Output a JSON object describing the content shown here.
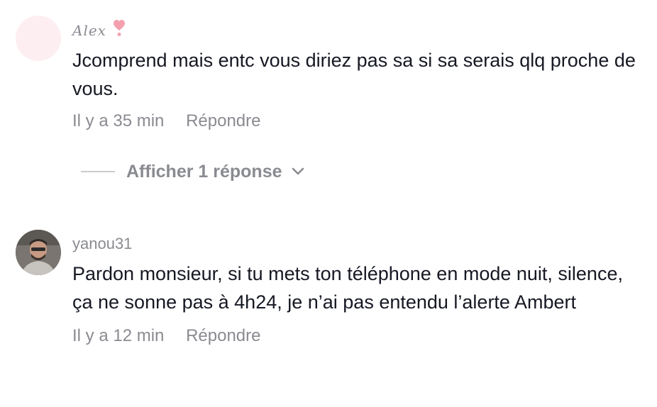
{
  "comments": [
    {
      "username": "Alex",
      "username_emoji": "heart-exclamation-icon",
      "text": "Jcomprend mais entc vous diriez pas sa si sa serais qlq proche de vous.",
      "time": "Il y a 35 min",
      "reply_label": "Répondre",
      "show_replies_label": "Afficher 1 réponse"
    },
    {
      "username": "yanou31",
      "text": "Pardon monsieur, si tu mets ton téléphone en mode nuit, silence, ça ne sonne pas à 4h24, je n’ai pas entendu l’alerte Ambert",
      "time": "Il y a 12 min",
      "reply_label": "Répondre"
    }
  ],
  "colors": {
    "text": "#161823",
    "muted": "#8a8b91",
    "heart": "#f4a0ae"
  }
}
